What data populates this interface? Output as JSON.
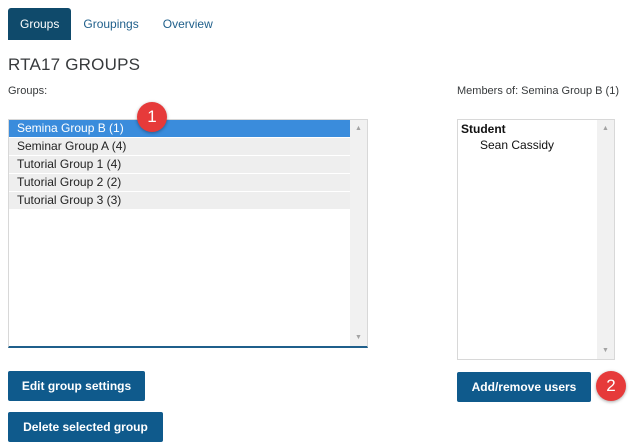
{
  "tabs": [
    {
      "label": "Groups",
      "active": true
    },
    {
      "label": "Groupings",
      "active": false
    },
    {
      "label": "Overview",
      "active": false
    }
  ],
  "page": {
    "title": "RTA17 GROUPS",
    "groups_label": "Groups:",
    "members_label": "Members of: Semina Group B (1)"
  },
  "groups_list": {
    "items": [
      {
        "label": "Semina Group B (1)",
        "selected": true
      },
      {
        "label": "Seminar Group A (4)",
        "selected": false
      },
      {
        "label": "Tutorial Group 1 (4)",
        "selected": false
      },
      {
        "label": "Tutorial Group 2 (2)",
        "selected": false
      },
      {
        "label": "Tutorial Group 3 (3)",
        "selected": false
      }
    ]
  },
  "members_list": {
    "role": "Student",
    "members": [
      "Sean Cassidy"
    ]
  },
  "buttons": {
    "edit": "Edit group settings",
    "delete": "Delete selected group",
    "add_remove": "Add/remove users"
  },
  "annotations": {
    "badge1": "1",
    "badge2": "2"
  },
  "icons": {
    "scroll_up": "triangle-up-icon",
    "scroll_down": "triangle-down-icon"
  },
  "colors": {
    "accent": "#0f5a8c",
    "tab_active": "#0f4a6b",
    "selection": "#3a8cdc",
    "badge": "#e63a3a"
  }
}
